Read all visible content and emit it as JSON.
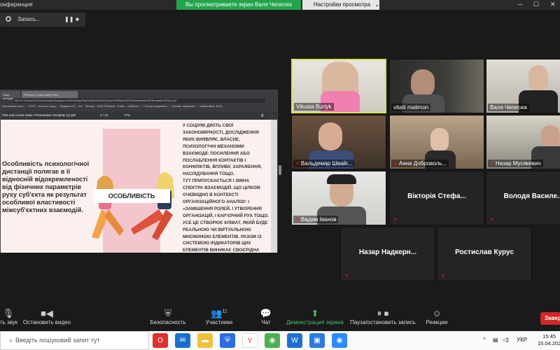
{
  "window": {
    "title": "Конференция",
    "title_visible": "онференция"
  },
  "share_banner": {
    "text": "Вы просматриваете экран Валя Чепесюк",
    "view_settings": "Настройки просмотра"
  },
  "recording": {
    "label": "Запись..."
  },
  "browser": {
    "tabs": [
      "Нова вкладка",
      "Pink and Cream Basic Pres"
    ],
    "url": "file:///C:/Users/1111/Downloads/Telegram%20Desktop/Pink%20and%20Cream%20Basic%20Presentation%20Template%20(1).pdf",
    "bookmarks": [
      "Программи теле...",
      "TEXT – итоги по мод...",
      "Видання 22 – н.в.",
      "Зв'язок",
      "2019 Pinterest",
      "Клиб — Бібліоте...",
      "Гіссгірх ендоменн...",
      "Основи лікування...",
      "militiamilitan 18:11"
    ],
    "pdf_title": "Pink and Cream Basic Presentation Template (1).pdf",
    "page": "4 / 34",
    "zoom": "77%"
  },
  "slide": {
    "left_text": "Особливість психологічної дистанції полягає в її відносній відокремленості від фізичних параметрів руху суб'єкта як результат особливої властивості міжсуб'єктних взаємодій.",
    "feature_label": "ОСОБЛИВІСТЬ",
    "right_text": "У соціумі діють свої закономірності, дослідження яких виявляє, власне, психологічні механізми взаємодії: посилення або послаблення контактів і конфліктів, впливу, зараження, наслідування тощо.\nТут припускається і зміна спектра взаємодій, що цілком очевидно в контексті організаційного аналізу: і «замішення ролей, і утворення організацій, і кар'єрний рух тощо. Усе це створює клімат, який буде реальною чи віртуальною множиною елементів. Разом із системою індикаторів цих елементів виникає своєрідна метрика"
  },
  "participants": [
    {
      "name": "Vikusia Burtyk",
      "muted": false,
      "video": true,
      "active": true
    },
    {
      "name": "vitalii malimon",
      "muted": false,
      "video": true
    },
    {
      "name": "Валя Чепесюк",
      "muted": false,
      "video": true
    },
    {
      "name": "Вальдемар Швайг...",
      "muted": true,
      "video": true
    },
    {
      "name": "Анна Доброволь...",
      "muted": true,
      "video": true
    },
    {
      "name": "Назар Мусякевич",
      "muted": true,
      "video": true
    },
    {
      "name": "Вадим Іванов",
      "muted": true,
      "video": true
    },
    {
      "name": "Вікторія Стефа...",
      "muted": true,
      "video": false
    },
    {
      "name": "Володя Василе...",
      "muted": true,
      "video": false
    },
    {
      "name": "Назар Надкерн...",
      "muted": true,
      "video": false
    },
    {
      "name": "Ростислав Курус",
      "muted": true,
      "video": false
    }
  ],
  "toolbar": {
    "mute": "ть звук",
    "video": "Остановить видео",
    "security": "Безопасность",
    "participants": "Участники",
    "participants_count": "11",
    "chat": "Чат",
    "share": "Демонстрация экрана",
    "pause_share": "Пауза/остановить запись",
    "reactions": "Реакции",
    "end": "Завер"
  },
  "taskbar": {
    "search_placeholder": "Введіть пошуковий запит тут",
    "lang": "УКР",
    "time": "15:45",
    "date": "15.04.202"
  },
  "colors": {
    "accent_green": "#23a44c",
    "active_border": "#d8e05a",
    "end_red": "#d32727",
    "slide_pink": "#f3c6cd"
  }
}
